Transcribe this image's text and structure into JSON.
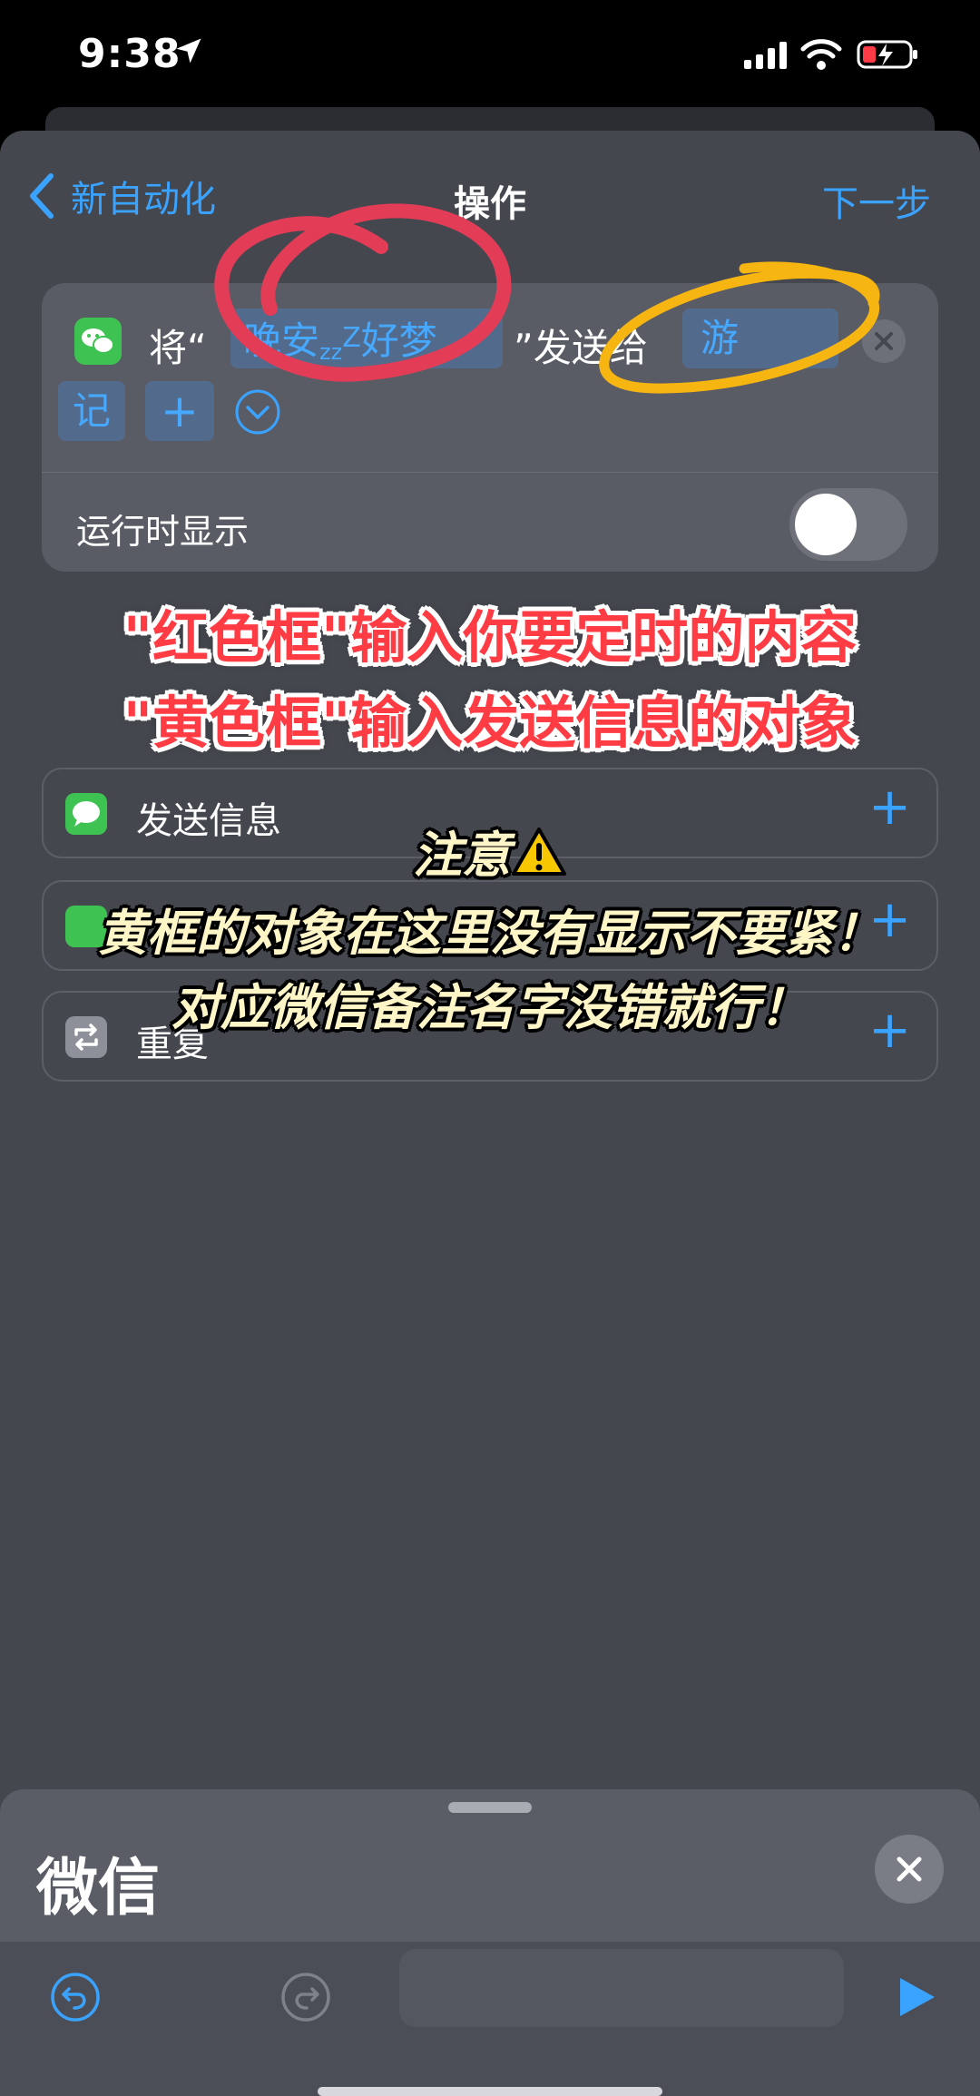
{
  "status_bar": {
    "time": "9:38"
  },
  "nav": {
    "back_label": "新自动化",
    "title": "操作",
    "next_label": "下一步"
  },
  "action": {
    "prefix": "将“",
    "content_before": "晚安",
    "content_zz_small": "z",
    "content_zz_mid": "z",
    "content_zz_big": "Z",
    "content_after": "好梦",
    "suffix": "”发送给",
    "recipient_part1": "游",
    "recipient_part2": "记",
    "add_symbol": "+",
    "run_label": "运行时显示",
    "run_toggle_on": false
  },
  "annotations": {
    "red_line1": "\"红色框\"输入你要定时的内容",
    "red_line2": "\"黄色框\"输入发送信息的对象",
    "note_title": "注意",
    "note_line1": "黄框的对象在这里没有显示不要紧！",
    "note_line2": "对应微信备注名字没错就行！"
  },
  "suggestions": [
    {
      "label": "发送信息",
      "icon": "messages-icon",
      "add": "+"
    },
    {
      "label": "",
      "icon": "wechat-icon",
      "add": "+"
    },
    {
      "label": "重复",
      "icon": "repeat-icon",
      "add": "+"
    }
  ],
  "bottom_panel": {
    "title": "微信"
  },
  "colors": {
    "accent": "#3aa3ff",
    "red_circle": "#e23c57",
    "yellow_circle": "#f7b512",
    "wechat_green": "#3ec252"
  }
}
